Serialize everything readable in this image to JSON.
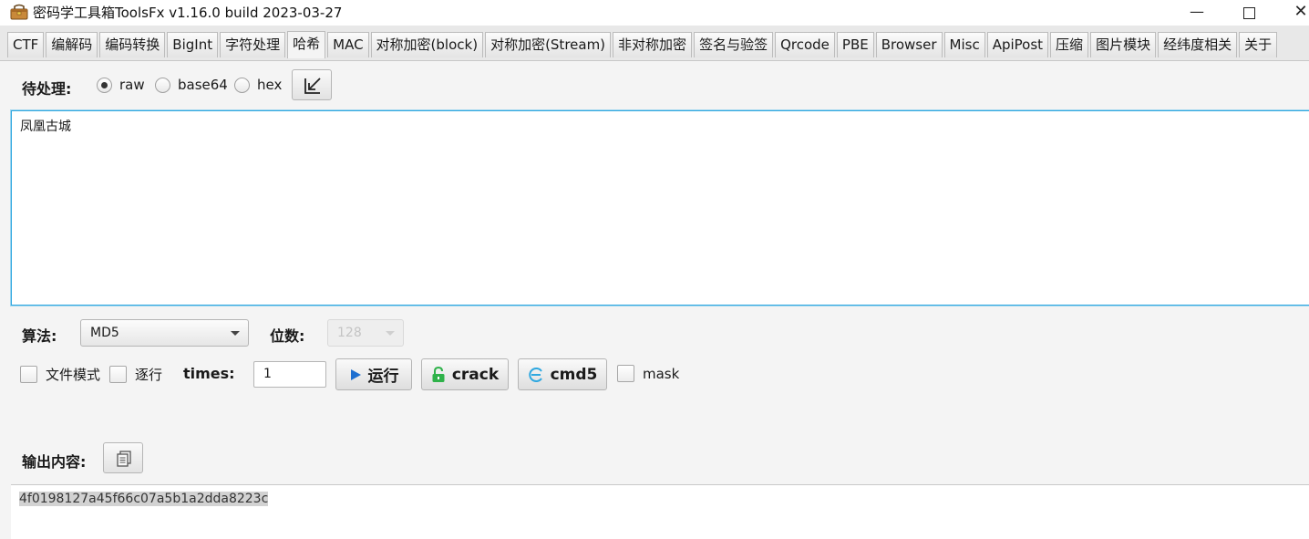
{
  "window": {
    "title": "密码学工具箱ToolsFx v1.16.0 build 2023-03-27",
    "min_glyph": "—",
    "close_glyph": "✕",
    "icon": "toolbox-icon"
  },
  "tabs": [
    {
      "label": "CTF"
    },
    {
      "label": "编解码"
    },
    {
      "label": "编码转换"
    },
    {
      "label": "BigInt"
    },
    {
      "label": "字符处理"
    },
    {
      "label": "哈希",
      "active": true
    },
    {
      "label": "MAC"
    },
    {
      "label": "对称加密(block)"
    },
    {
      "label": "对称加密(Stream)"
    },
    {
      "label": "非对称加密"
    },
    {
      "label": "签名与验签"
    },
    {
      "label": "Qrcode"
    },
    {
      "label": "PBE"
    },
    {
      "label": "Browser"
    },
    {
      "label": "Misc"
    },
    {
      "label": "ApiPost"
    },
    {
      "label": "压缩"
    },
    {
      "label": "图片模块"
    },
    {
      "label": "经纬度相关"
    },
    {
      "label": "关于"
    }
  ],
  "input": {
    "label": "待处理:",
    "formats": [
      {
        "label": "raw",
        "selected": true
      },
      {
        "label": "base64",
        "selected": false
      },
      {
        "label": "hex",
        "selected": false
      }
    ],
    "import_icon": "import-arrow-icon",
    "text": "凤凰古城"
  },
  "algorithm": {
    "label": "算法:",
    "selected": "MD5",
    "bits_label": "位数:",
    "bits_value": "128"
  },
  "options": {
    "file_mode": {
      "label": "文件模式",
      "checked": false
    },
    "line_by_line": {
      "label": "逐行",
      "checked": false
    },
    "times_label": "times:",
    "times_value": "1",
    "run_label": "运行",
    "crack_label": "crack",
    "cmd5_label": "cmd5",
    "mask": {
      "label": "mask",
      "checked": false
    }
  },
  "output": {
    "label": "输出内容:",
    "copy_icon": "copy-icon",
    "text": "4f0198127a45f66c07a5b1a2dda8223c"
  },
  "colors": {
    "focus": "#2fa8e0",
    "run_icon": "#1e6fd0",
    "crack_icon": "#2fb24a",
    "cmd5_icon": "#2fa8e0"
  }
}
